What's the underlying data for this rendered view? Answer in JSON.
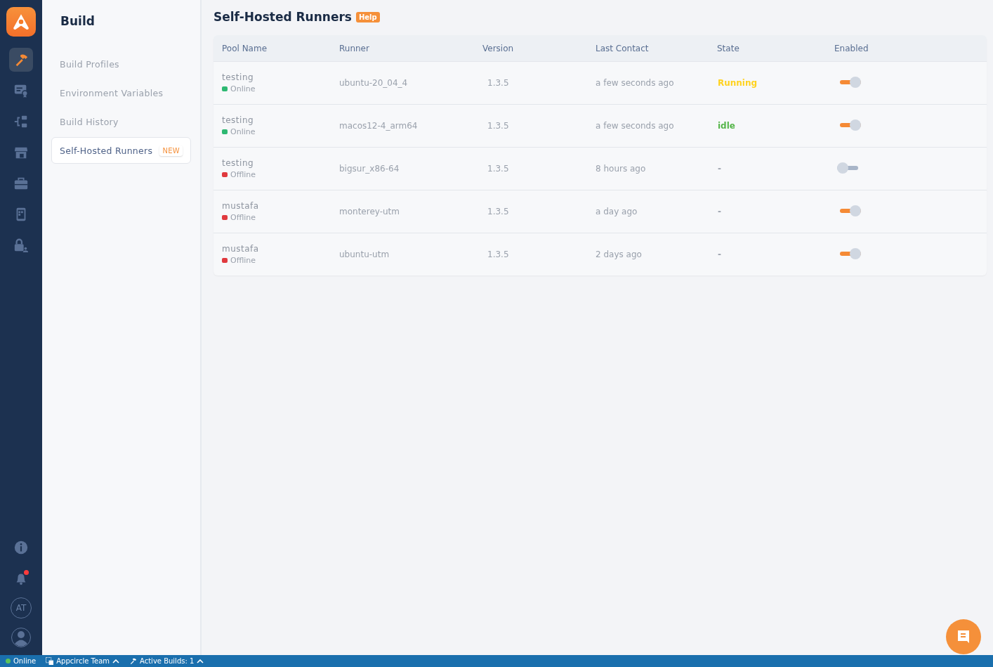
{
  "rail": {
    "top": [
      {
        "kind": "hammer",
        "selected": true
      },
      {
        "kind": "certificate",
        "selected": false
      },
      {
        "kind": "flow",
        "selected": false
      },
      {
        "kind": "store",
        "selected": false
      },
      {
        "kind": "briefcase",
        "selected": false
      },
      {
        "kind": "device",
        "selected": false
      },
      {
        "kind": "lock",
        "selected": false
      }
    ],
    "notifications_unread": true,
    "avatar_initials": "AT"
  },
  "sidebar": {
    "title": "Build",
    "items": [
      {
        "label": "Build Profiles",
        "selected": false
      },
      {
        "label": "Environment Variables",
        "selected": false
      },
      {
        "label": "Build History",
        "selected": false
      },
      {
        "label": "Self-Hosted Runners",
        "selected": true,
        "badge": "NEW"
      }
    ]
  },
  "page": {
    "title": "Self-Hosted Runners",
    "help": "Help"
  },
  "table": {
    "columns": [
      "Pool Name",
      "Runner",
      "Version",
      "Last Contact",
      "State",
      "Enabled"
    ],
    "rows": [
      {
        "pool": "testing",
        "status": "Online",
        "color": "#2eb872",
        "runner": "ubuntu-20_04_4",
        "version": "1.3.5",
        "last_contact": "a few seconds ago",
        "state": {
          "label": "Running",
          "color": "#ffd21f"
        },
        "on": true
      },
      {
        "pool": "testing",
        "status": "Online",
        "color": "#2eb872",
        "runner": "macos12-4_arm64",
        "version": "1.3.5",
        "last_contact": "a few seconds ago",
        "state": {
          "label": "idle",
          "color": "#56b64a"
        },
        "on": true
      },
      {
        "pool": "testing",
        "status": "Offline",
        "color": "#e0393e",
        "runner": "bigsur_x86-64",
        "version": "1.3.5",
        "last_contact": "8 hours ago",
        "state": {
          "label": "-",
          "color": "#9aa1ac"
        },
        "on": false
      },
      {
        "pool": "mustafa",
        "status": "Offline",
        "color": "#e0393e",
        "runner": "monterey-utm",
        "version": "1.3.5",
        "last_contact": "a day ago",
        "state": {
          "label": "-",
          "color": "#9aa1ac"
        },
        "on": true
      },
      {
        "pool": "mustafa",
        "status": "Offline",
        "color": "#e0393e",
        "runner": "ubuntu-utm",
        "version": "1.3.5",
        "last_contact": "2 days ago",
        "state": {
          "label": "-",
          "color": "#9aa1ac"
        },
        "on": true
      }
    ]
  },
  "status_bar": {
    "connection": "Online",
    "online": true,
    "team": "Appcircle Team",
    "builds": "Active Builds: 1"
  }
}
